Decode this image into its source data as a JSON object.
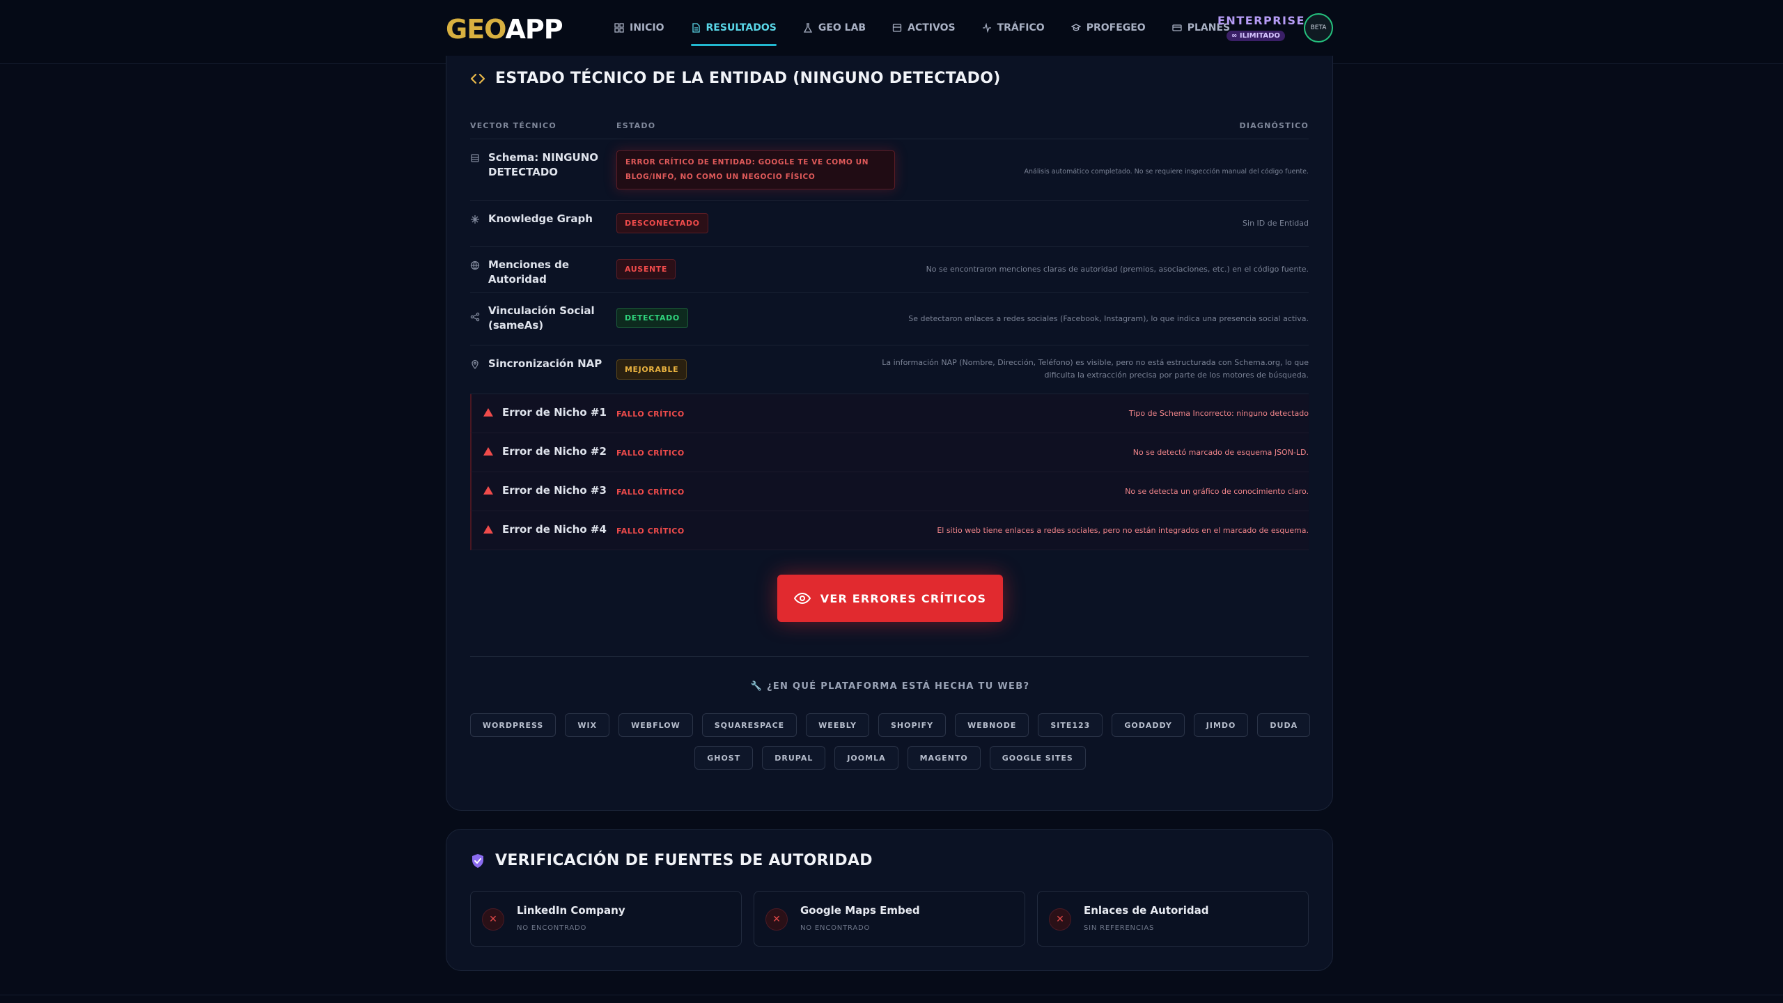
{
  "nav": {
    "logo_geo": "GEO",
    "logo_app": "APP",
    "items": [
      {
        "label": "INICIO",
        "icon": "grid-icon"
      },
      {
        "label": "RESULTADOS",
        "icon": "document-icon"
      },
      {
        "label": "GEO LAB",
        "icon": "flask-icon"
      },
      {
        "label": "ACTIVOS",
        "icon": "box-icon"
      },
      {
        "label": "TRÁFICO",
        "icon": "activity-icon"
      },
      {
        "label": "PROFEGEO",
        "icon": "graduation-cap-icon"
      },
      {
        "label": "PLANES",
        "icon": "credit-card-icon"
      }
    ],
    "plan_name": "ENTERPRISE",
    "plan_badge": "∞ ILIMITADO",
    "avatar_text": "BETA"
  },
  "technical": {
    "title": "ESTADO TÉCNICO DE LA ENTIDAD (NINGUNO DETECTADO)",
    "headers": {
      "vector": "VECTOR TÉCNICO",
      "estado": "ESTADO",
      "diagnostico": "DIAGNÓSTICO"
    },
    "rows": [
      {
        "label": "Schema: NINGUNO DETECTADO",
        "status": "ERROR CRÍTICO DE ENTIDAD: GOOGLE TE VE COMO UN BLOG/INFO, NO COMO UN NEGOCIO FÍSICO",
        "diag": "Análisis automático completado. No se requiere inspección manual del código fuente."
      },
      {
        "label": "Knowledge Graph",
        "status": "DESCONECTADO",
        "diag": "Sin ID de Entidad"
      },
      {
        "label": "Menciones de Autoridad",
        "status": "AUSENTE",
        "diag": "No se encontraron menciones claras de autoridad (premios, asociaciones, etc.) en el código fuente."
      },
      {
        "label": "Vinculación Social (sameAs)",
        "status": "DETECTADO",
        "diag": "Se detectaron enlaces a redes sociales (Facebook, Instagram), lo que indica una presencia social activa."
      },
      {
        "label": "Sincronización NAP",
        "status": "MEJORABLE",
        "diag_line1": "La información NAP (Nombre, Dirección, Teléfono) es visible, pero no está estructurada con Schema.org, lo que",
        "diag_line2": "dificulta la extracción precisa por parte de los motores de búsqueda."
      }
    ],
    "niche_errors": [
      {
        "label": "Error de Nicho #1",
        "status": "FALLO CRÍTICO",
        "diag": "Tipo de Schema Incorrecto: ninguno detectado"
      },
      {
        "label": "Error de Nicho #2",
        "status": "FALLO CRÍTICO",
        "diag": "No se detectó marcado de esquema JSON-LD."
      },
      {
        "label": "Error de Nicho #3",
        "status": "FALLO CRÍTICO",
        "diag": "No se detecta un gráfico de conocimiento claro."
      },
      {
        "label": "Error de Nicho #4",
        "status": "FALLO CRÍTICO",
        "diag": "El sitio web tiene enlaces a redes sociales, pero no están integrados en el marcado de esquema."
      }
    ],
    "cta_label": "VER ERRORES CRÍTICOS"
  },
  "platform": {
    "question": "🔧 ¿EN QUÉ PLATAFORMA ESTÁ HECHA TU WEB?",
    "row1": [
      "WORDPRESS",
      "WIX",
      "WEBFLOW",
      "SQUARESPACE",
      "WEEBLY",
      "SHOPIFY",
      "WEBNODE",
      "SITE123",
      "GODADDY",
      "JIMDO",
      "DUDA"
    ],
    "row2": [
      "GHOST",
      "DRUPAL",
      "JOOMLA",
      "MAGENTO",
      "GOOGLE SITES"
    ]
  },
  "authority": {
    "title": "VERIFICACIÓN DE FUENTES DE AUTORIDAD",
    "sources": [
      {
        "name": "LinkedIn Company",
        "status": "NO ENCONTRADO"
      },
      {
        "name": "Google Maps Embed",
        "status": "NO ENCONTRADO"
      },
      {
        "name": "Enlaces de Autoridad",
        "status": "SIN REFERENCIAS"
      }
    ]
  },
  "colors": {
    "accent": "#22b8d0",
    "danger": "#e12a2f",
    "success": "#2fd27c",
    "warning": "#e9b23f",
    "logo": "#d8b040"
  }
}
